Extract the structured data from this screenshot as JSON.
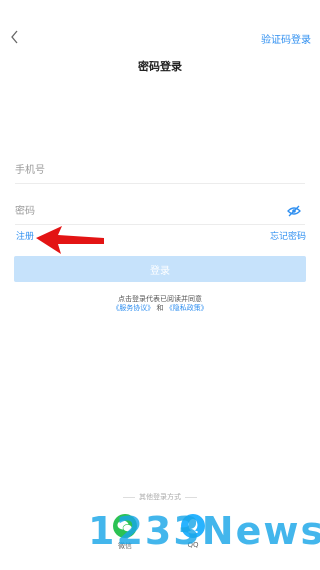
{
  "header": {
    "back_icon": "chevron-left-icon",
    "switch_label": "验证码登录",
    "title": "密码登录"
  },
  "form": {
    "phone_placeholder": "手机号",
    "password_placeholder": "密码",
    "eye_icon": "eye-off-icon",
    "register_label": "注册",
    "forgot_label": "忘记密码",
    "login_label": "登录"
  },
  "agreement": {
    "line1": "点击登录代表已阅读并同意",
    "service": "《服务协议》",
    "and": "和",
    "privacy": "《隐私政策》"
  },
  "other_login": {
    "title": "其他登录方式",
    "options": [
      {
        "label": "微信",
        "icon": "wechat-icon"
      },
      {
        "label": "QQ",
        "icon": "qq-icon"
      }
    ]
  },
  "watermark": {
    "text": "1233News"
  },
  "colors": {
    "accent": "#2f8ff0",
    "login_disabled": "#c6e2fb",
    "arrow": "#e31414",
    "wechat": "#2bc253",
    "qq": "#28b3ff"
  }
}
